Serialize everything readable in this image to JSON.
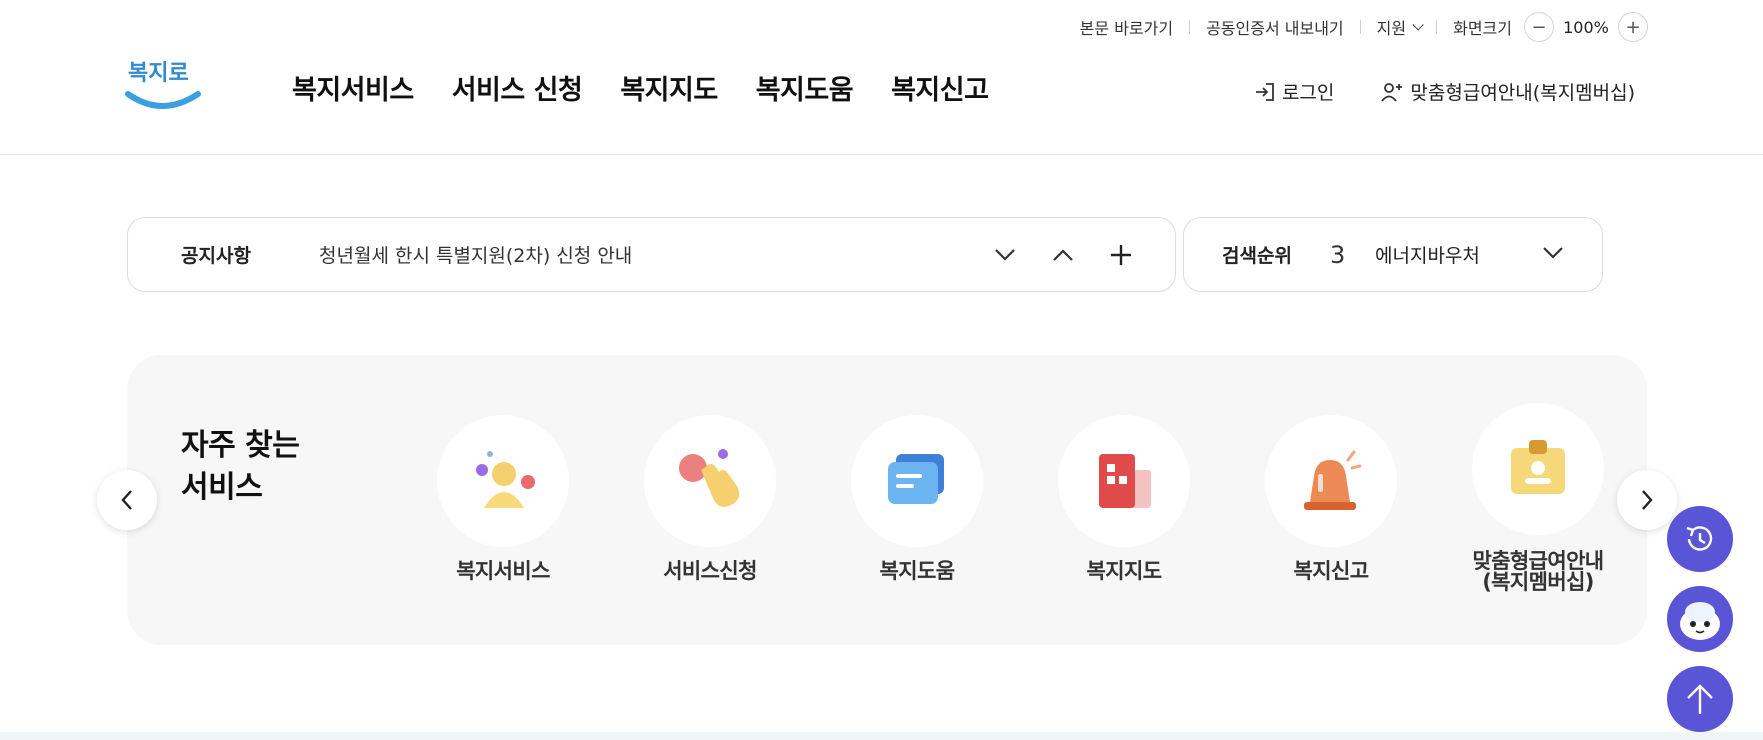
{
  "util": {
    "skip_link": "본문 바로가기",
    "cert_export": "공동인증서 내보내기",
    "support": "지원",
    "zoom_label": "화면크기",
    "zoom_minus": "−",
    "zoom_value": "100%",
    "zoom_plus": "+"
  },
  "header": {
    "logo_text": "복지로",
    "nav": [
      "복지서비스",
      "서비스 신청",
      "복지지도",
      "복지도움",
      "복지신고"
    ],
    "login": "로그인",
    "membership": "맞춤형급여안내(복지멤버십)"
  },
  "notice": {
    "label": "공지사항",
    "text": "청년월세 한시 특별지원(2차) 신청 안내"
  },
  "search_rank": {
    "label": "검색순위",
    "rank": "3",
    "keyword": "에너지바우처"
  },
  "services": {
    "title_line1": "자주 찾는",
    "title_line2": "서비스",
    "items": [
      {
        "label": "복지서비스",
        "icon": "people-icon"
      },
      {
        "label": "서비스신청",
        "icon": "hand-tap-icon"
      },
      {
        "label": "복지도움",
        "icon": "chat-icon"
      },
      {
        "label": "복지지도",
        "icon": "building-icon"
      },
      {
        "label": "복지신고",
        "icon": "siren-icon"
      },
      {
        "label_line1": "맞춤형급여안내",
        "label_line2": "(복지멤버십)",
        "icon": "badge-icon"
      }
    ]
  },
  "colors": {
    "accent": "#5a55d6",
    "logo_blue": "#3aa0e0"
  }
}
